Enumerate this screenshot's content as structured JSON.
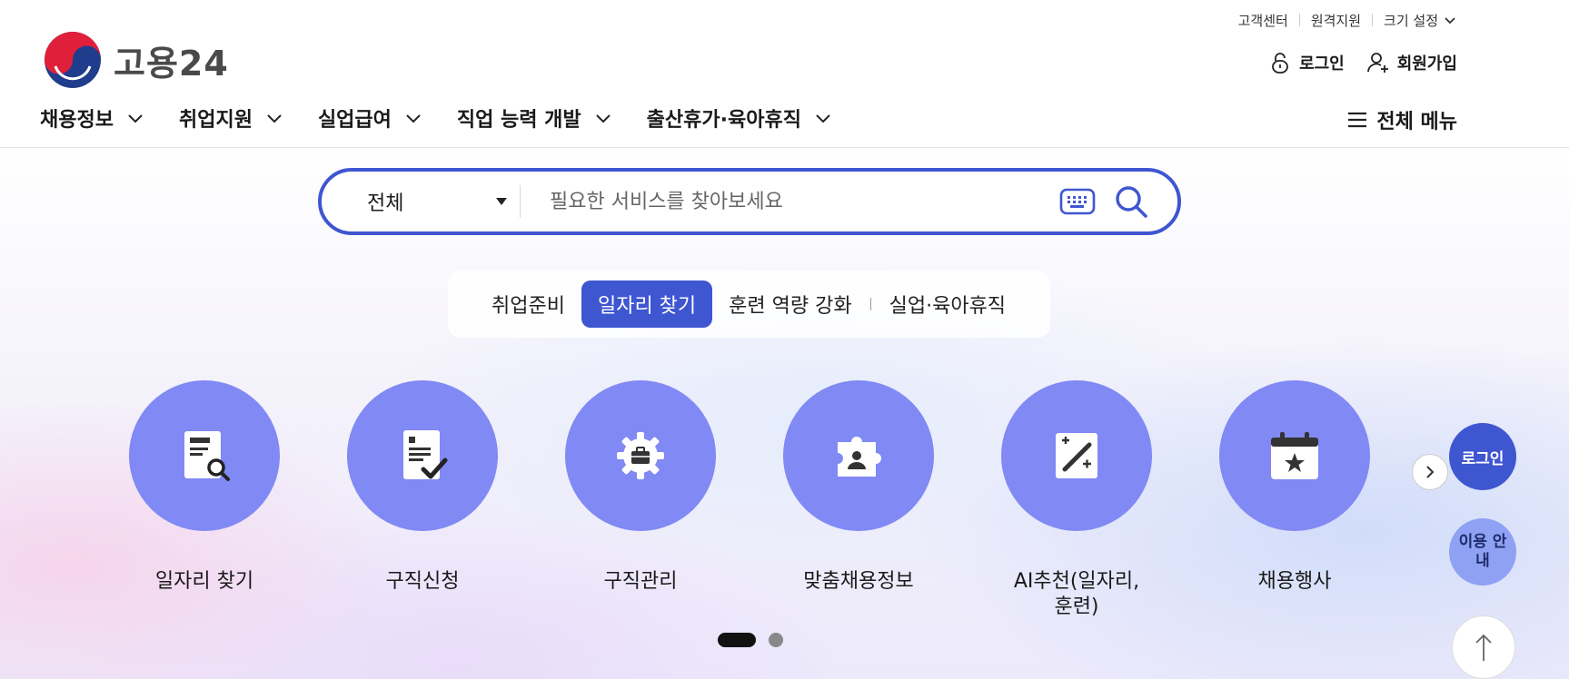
{
  "header": {
    "logo_text": "고용24",
    "util_links": [
      "고객센터",
      "원격지원"
    ],
    "font_size_setting": "크기 설정",
    "login": "로그인",
    "signup": "회원가입",
    "nav": [
      "채용정보",
      "취업지원",
      "실업급여",
      "직업 능력 개발",
      "출산휴가·육아휴직"
    ],
    "all_menu": "전체 메뉴"
  },
  "search": {
    "category": "전체",
    "placeholder": "필요한 서비스를 찾아보세요"
  },
  "tabs": [
    {
      "label": "취업준비",
      "active": false
    },
    {
      "label": "일자리 찾기",
      "active": true
    },
    {
      "label": "훈련 역량 강화",
      "active": false
    },
    {
      "label": "실업·육아휴직",
      "active": false
    }
  ],
  "services": [
    {
      "label": "일자리 찾기",
      "icon": "job-search-icon"
    },
    {
      "label": "구직신청",
      "icon": "application-check-icon"
    },
    {
      "label": "구직관리",
      "icon": "gear-briefcase-icon"
    },
    {
      "label": "맞춤채용정보",
      "icon": "puzzle-person-icon"
    },
    {
      "label": "AI추천(일자리, 훈련)",
      "icon": "magic-wand-icon"
    },
    {
      "label": "채용행사",
      "icon": "calendar-star-icon"
    }
  ],
  "carousel": {
    "current_page": 1,
    "total_pages": 2
  },
  "floating": {
    "login": "로그인",
    "guide": "이용 안내"
  },
  "colors": {
    "primary": "#3f56d1",
    "service_circle": "#8089f4",
    "guide_button": "#8ea1f2"
  }
}
